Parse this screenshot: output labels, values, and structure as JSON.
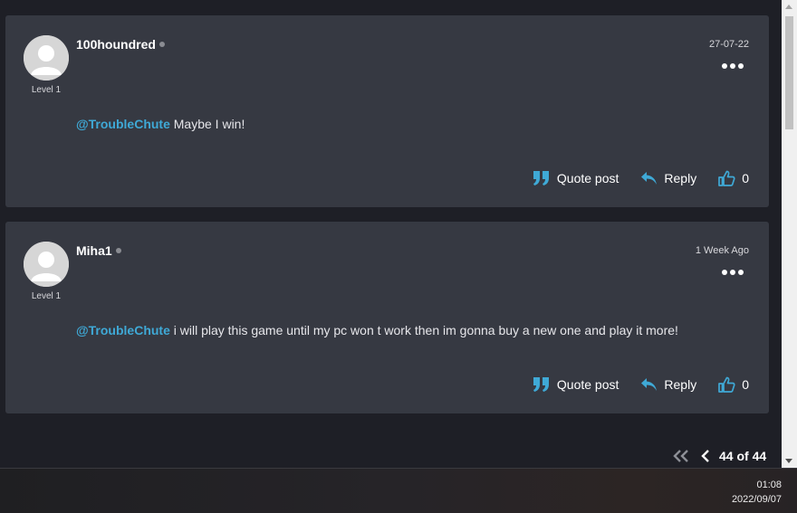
{
  "posts": [
    {
      "username": "100houndred",
      "level": "Level 1",
      "date": "27-07-22",
      "mention": "@TroubleChute",
      "text": " Maybe I win!",
      "quote_label": "Quote post",
      "reply_label": "Reply",
      "likes": "0"
    },
    {
      "username": "Miha1",
      "level": "Level 1",
      "date": "1 Week Ago",
      "mention": "@TroubleChute",
      "text": " i will play this game until my pc won t work then im gonna buy a new one and play it more!",
      "quote_label": "Quote post",
      "reply_label": "Reply",
      "likes": "0"
    }
  ],
  "pagination": {
    "label": "44 of 44"
  },
  "taskbar": {
    "time": "01:08",
    "date": "2022/09/07"
  },
  "colors": {
    "accent": "#3fa9d6",
    "card": "#363942",
    "background": "#1e1f26"
  },
  "icons": [
    "quote-icon",
    "reply-icon",
    "thumbs-up-icon",
    "more-options-icon",
    "first-page-icon",
    "previous-page-icon"
  ]
}
